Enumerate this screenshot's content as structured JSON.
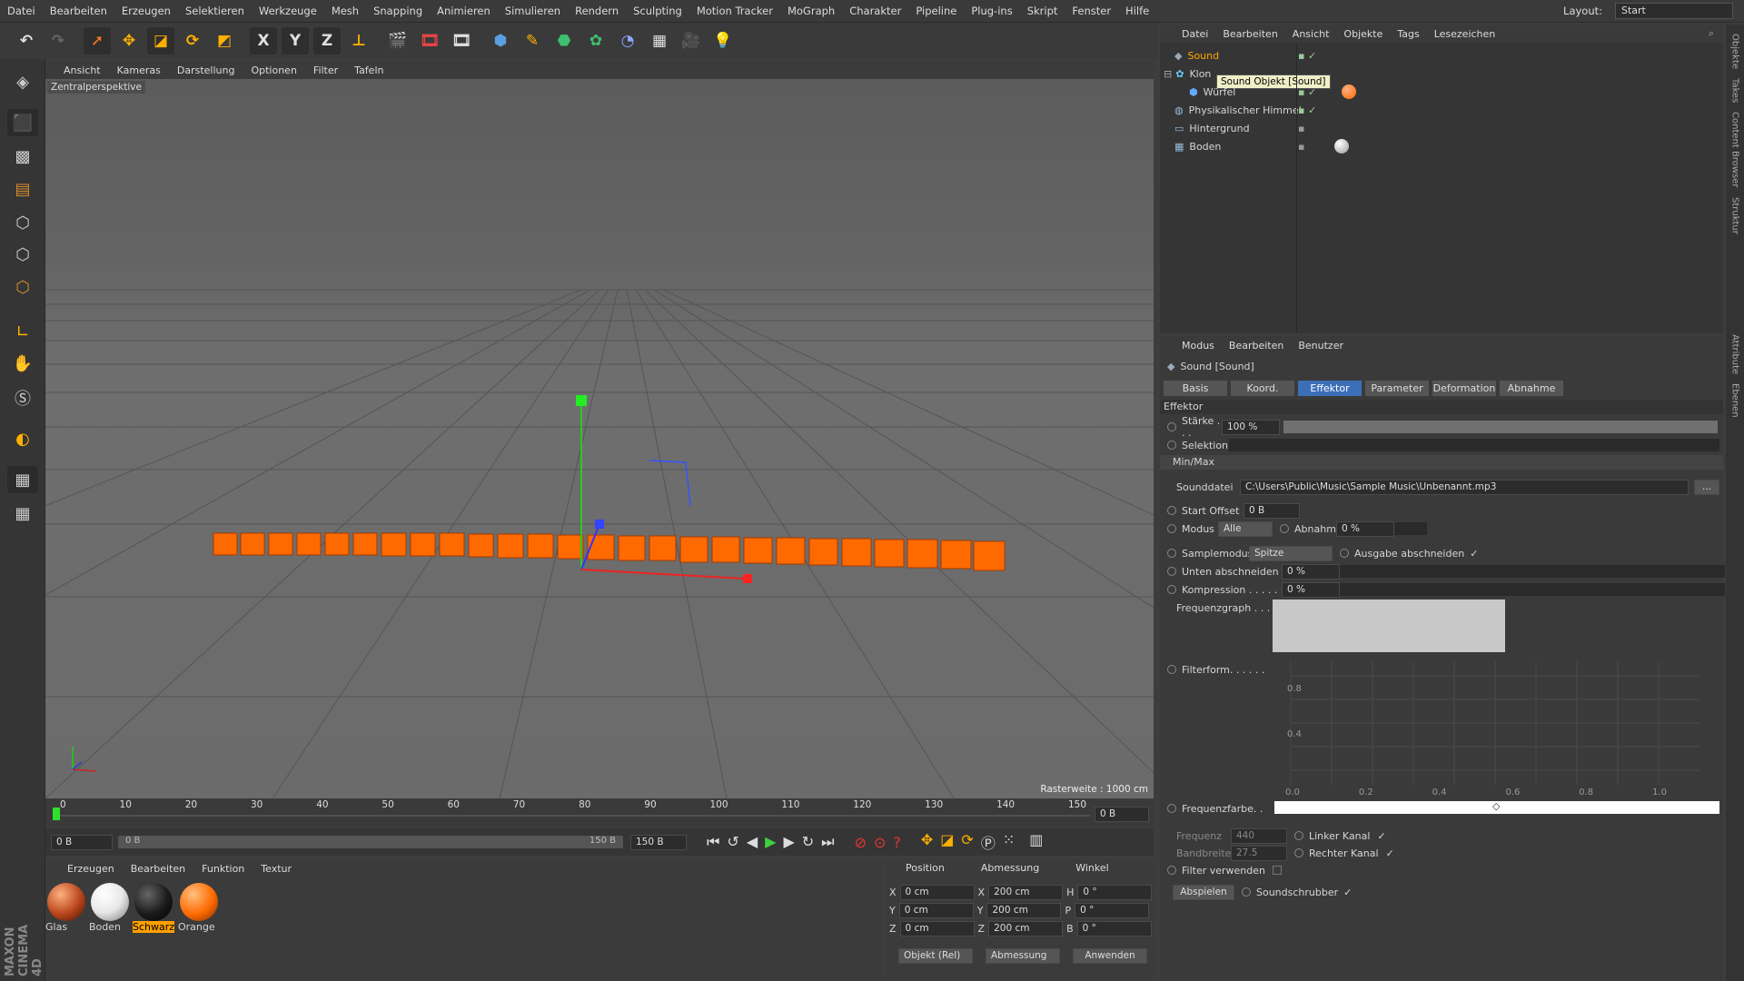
{
  "menubar": {
    "items": [
      "Datei",
      "Bearbeiten",
      "Erzeugen",
      "Selektieren",
      "Werkzeuge",
      "Mesh",
      "Snapping",
      "Animieren",
      "Simulieren",
      "Rendern",
      "Sculpting",
      "Motion Tracker",
      "MoGraph",
      "Charakter",
      "Pipeline",
      "Plug-ins",
      "Skript",
      "Fenster",
      "Hilfe"
    ],
    "layout_label": "Layout:",
    "layout_value": "Start"
  },
  "toolbar": {
    "x": "X",
    "y": "Y",
    "z": "Z"
  },
  "viewport": {
    "menu": [
      "Ansicht",
      "Kameras",
      "Darstellung",
      "Optionen",
      "Filter",
      "Tafeln"
    ],
    "label": "Zentralperspektive",
    "raster": "Rasterweite : 1000 cm"
  },
  "timeline": {
    "ticks": [
      "0",
      "10",
      "20",
      "30",
      "40",
      "50",
      "60",
      "70",
      "80",
      "90",
      "100",
      "110",
      "120",
      "130",
      "140",
      "150"
    ],
    "current": "0 B",
    "start": "0 B",
    "slider_left": "0 B",
    "slider_right": "150 B",
    "end": "150 B"
  },
  "materials": {
    "menu": [
      "Erzeugen",
      "Bearbeiten",
      "Funktion",
      "Textur"
    ],
    "items": [
      {
        "name": "Glas",
        "color": "#b8441a"
      },
      {
        "name": "Boden",
        "color": "#e8e8e8"
      },
      {
        "name": "Schwarz",
        "color": "#1a1a1a"
      },
      {
        "name": "Orange",
        "color": "#ff6a00"
      }
    ]
  },
  "coords": {
    "headers": [
      "Position",
      "Abmessung",
      "Winkel"
    ],
    "rows": [
      {
        "axis": "X",
        "pos": "0 cm",
        "dimaxis": "X",
        "dim": "200 cm",
        "angaxis": "H",
        "ang": "0 °"
      },
      {
        "axis": "Y",
        "pos": "0 cm",
        "dimaxis": "Y",
        "dim": "200 cm",
        "angaxis": "P",
        "ang": "0 °"
      },
      {
        "axis": "Z",
        "pos": "0 cm",
        "dimaxis": "Z",
        "dim": "200 cm",
        "angaxis": "B",
        "ang": "0 °"
      }
    ],
    "mode": "Objekt (Rel)",
    "size": "Abmessung",
    "apply": "Anwenden"
  },
  "objects": {
    "menu": [
      "Datei",
      "Bearbeiten",
      "Ansicht",
      "Objekte",
      "Tags",
      "Lesezeichen"
    ],
    "items": [
      "Sound",
      "Klon",
      "Würfel",
      "Physikalischer Himmel",
      "Hintergrund",
      "Boden"
    ],
    "tooltip": "Sound Objekt [Sound]"
  },
  "attributes": {
    "menu": [
      "Modus",
      "Bearbeiten",
      "Benutzer"
    ],
    "title": "Sound [Sound]",
    "tabs": [
      "Basis",
      "Koord.",
      "Effektor",
      "Parameter",
      "Deformation",
      "Abnahme"
    ],
    "section": "Effektor",
    "staerke_label": "Stärke . . .",
    "staerke": "100 %",
    "selektion": "Selektion",
    "minmax": "Min/Max",
    "sounddatei_label": "Sounddatei",
    "sounddatei": "C:\\Users\\Public\\Music\\Sample Music\\Unbenannt.mp3",
    "browse": "...",
    "startoffset_label": "Start Offset",
    "startoffset": "0 B",
    "modus_label": "Modus",
    "modus": "Alle",
    "abnahme_label": "Abnahme",
    "abnahme": "0 %",
    "samplemodus_label": "Samplemodus",
    "samplemodus": "Spitze",
    "ausgabe": "Ausgabe abschneiden",
    "unten_label": "Unten abschneiden",
    "unten": "0 %",
    "kompression_label": "Kompression . . . . .",
    "kompression": "0 %",
    "frequenzgraph": "Frequenzgraph . . .",
    "filterform": "Filterform. . . . . .",
    "graph_y": [
      "0.8",
      "0.4"
    ],
    "graph_x": [
      "0.0",
      "0.2",
      "0.4",
      "0.6",
      "0.8",
      "1.0"
    ],
    "frequenzfarbe": "Frequenzfarbe. .",
    "frequenz_label": "Frequenz",
    "frequenz": "440",
    "bandbreite_label": "Bandbreite",
    "bandbreite": "27.5",
    "linker": "Linker Kanal",
    "rechter": "Rechter Kanal",
    "filter": "Filter verwenden",
    "abspielen": "Abspielen",
    "soundschrubber": "Soundschrubber"
  },
  "rightstrip": [
    "Objekte",
    "Takes",
    "Content Browser",
    "Struktur",
    "Attribute",
    "Ebenen"
  ],
  "brand": "MAXON CINEMA 4D"
}
